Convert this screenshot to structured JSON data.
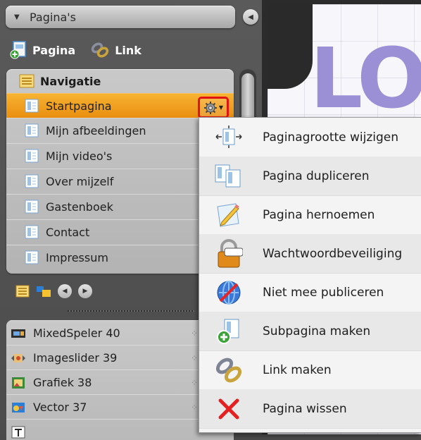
{
  "panel": {
    "section_title": "Pagina's",
    "add_page_label": "Pagina",
    "add_link_label": "Link"
  },
  "navigation": {
    "title": "Navigatie",
    "items": [
      {
        "label": "Startpagina",
        "selected": true
      },
      {
        "label": "Mijn afbeeldingen"
      },
      {
        "label": "Mijn video's"
      },
      {
        "label": "Over mijzelf"
      },
      {
        "label": "Gastenboek"
      },
      {
        "label": "Contact"
      },
      {
        "label": "Impressum"
      }
    ]
  },
  "objects": {
    "items": [
      {
        "label": "MixedSpeler 40",
        "icon": "film-icon"
      },
      {
        "label": "Imageslider 39",
        "icon": "image-slider-icon"
      },
      {
        "label": "Grafiek 38",
        "icon": "picture-icon"
      },
      {
        "label": "Vector 37",
        "icon": "vector-icon"
      },
      {
        "label": "",
        "icon": "text-icon"
      }
    ]
  },
  "context_menu": {
    "items": [
      {
        "label": "Paginagrootte wijzigen",
        "icon": "resize-page-icon"
      },
      {
        "label": "Pagina dupliceren",
        "icon": "duplicate-page-icon"
      },
      {
        "label": "Pagina hernoemen",
        "icon": "rename-page-icon"
      },
      {
        "label": "Wachtwoordbeveiliging",
        "icon": "padlock-icon"
      },
      {
        "label": "Niet mee publiceren",
        "icon": "no-publish-globe-icon"
      },
      {
        "label": "Subpagina maken",
        "icon": "add-subpage-icon"
      },
      {
        "label": "Link maken",
        "icon": "chain-link-icon"
      },
      {
        "label": "Pagina wissen",
        "icon": "delete-x-icon"
      }
    ]
  },
  "canvas": {
    "logo_text": "LO"
  },
  "colors": {
    "selected_row": "#f0a020",
    "highlight_border": "#e01414",
    "logo": "#9b8fd6"
  }
}
